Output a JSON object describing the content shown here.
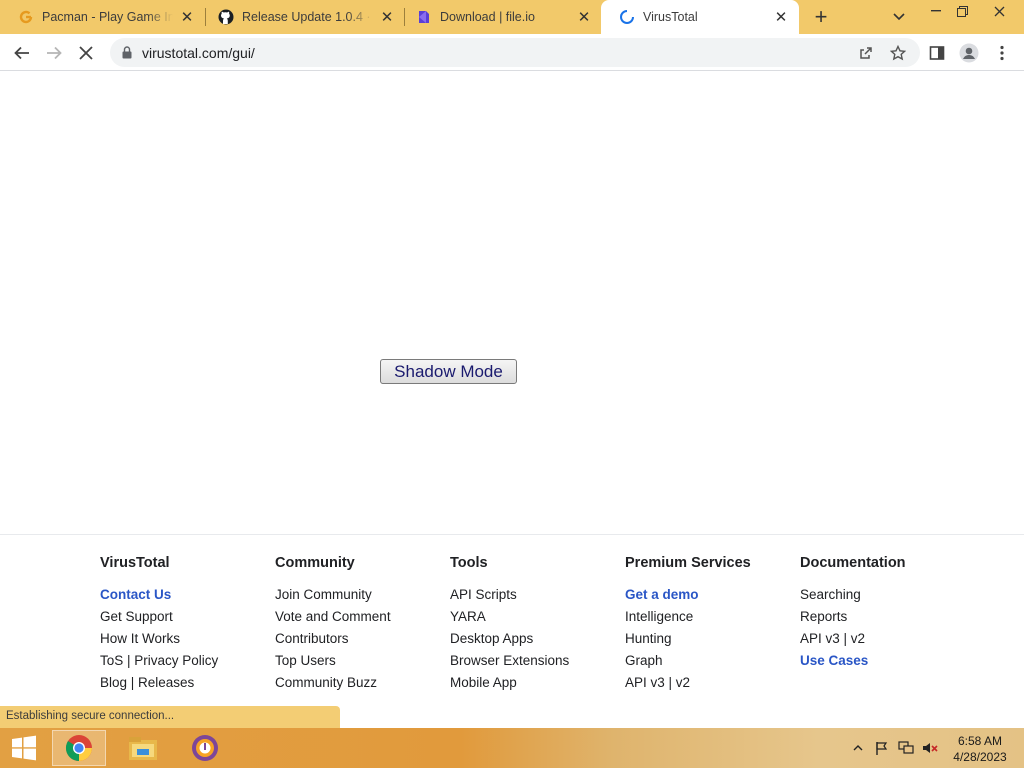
{
  "browser": {
    "tabs": [
      {
        "title": "Pacman - Play Game Inst",
        "icon": "google-doodle-icon",
        "active": false
      },
      {
        "title": "Release Update 1.0.4 · the",
        "icon": "github-icon",
        "active": false
      },
      {
        "title": "Download | file.io",
        "icon": "fileio-icon",
        "active": false
      },
      {
        "title": "VirusTotal",
        "icon": "loading-spinner-icon",
        "active": true
      }
    ],
    "new_tab_symbol": "+",
    "url": "virustotal.com/gui/"
  },
  "page": {
    "shadow_button_label": "Shadow Mode",
    "footer": {
      "columns": [
        {
          "heading": "VirusTotal",
          "links": [
            {
              "text": "Contact Us",
              "highlight": true
            },
            {
              "text": "Get Support",
              "highlight": false
            },
            {
              "text": "How It Works",
              "highlight": false
            },
            {
              "text": "ToS | Privacy Policy",
              "highlight": false
            },
            {
              "text": "Blog | Releases",
              "highlight": false
            }
          ]
        },
        {
          "heading": "Community",
          "links": [
            {
              "text": "Join Community",
              "highlight": false
            },
            {
              "text": "Vote and Comment",
              "highlight": false
            },
            {
              "text": "Contributors",
              "highlight": false
            },
            {
              "text": "Top Users",
              "highlight": false
            },
            {
              "text": "Community Buzz",
              "highlight": false
            }
          ]
        },
        {
          "heading": "Tools",
          "links": [
            {
              "text": "API Scripts",
              "highlight": false
            },
            {
              "text": "YARA",
              "highlight": false
            },
            {
              "text": "Desktop Apps",
              "highlight": false
            },
            {
              "text": "Browser Extensions",
              "highlight": false
            },
            {
              "text": "Mobile App",
              "highlight": false
            }
          ]
        },
        {
          "heading": "Premium Services",
          "links": [
            {
              "text": "Get a demo",
              "highlight": true
            },
            {
              "text": "Intelligence",
              "highlight": false
            },
            {
              "text": "Hunting",
              "highlight": false
            },
            {
              "text": "Graph",
              "highlight": false
            },
            {
              "text": "API v3 | v2",
              "highlight": false
            }
          ]
        },
        {
          "heading": "Documentation",
          "links": [
            {
              "text": "Searching",
              "highlight": false
            },
            {
              "text": "Reports",
              "highlight": false
            },
            {
              "text": "API v3 | v2",
              "highlight": false
            },
            {
              "text": "Use Cases",
              "highlight": true
            }
          ]
        }
      ]
    }
  },
  "status_text": "Establishing secure connection...",
  "taskbar": {
    "apps": [
      "chrome-icon",
      "file-explorer-icon",
      "tor-browser-icon"
    ],
    "time": "6:58 AM",
    "date": "4/28/2023"
  },
  "colors": {
    "tabstrip": "#f2c96a",
    "link_blue": "#2a56c6",
    "status_bubble": "#f3cd74"
  }
}
